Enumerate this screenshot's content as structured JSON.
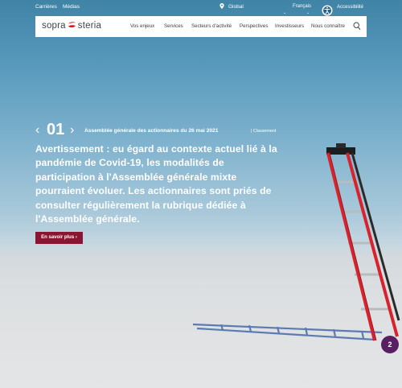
{
  "topbar": {
    "links": [
      "Carrières",
      "Médias"
    ],
    "region": "Global",
    "language": "Français",
    "accessibility": "Accessibilité"
  },
  "navbar": {
    "logo_left": "sopra",
    "logo_right": "steria",
    "items": [
      "Vos enjeux",
      "Services",
      "Secteurs d'activité",
      "Perspectives",
      "Investisseurs",
      "Nous connaître"
    ]
  },
  "hero": {
    "slide_number": "01",
    "event_title": "Assemblée générale des actionnaires du 26 mai 2021",
    "event_category": "Classement",
    "headline": "Avertissement : eu égard au contexte actuel lié à la pandémie de Covid-19, les modalités de participation à l'Assemblée générale mixte pourraient évoluer. Les actionnaires sont priés de consulter régulièrement la rubrique dédiée à l'Assemblée générale.",
    "cta_label": "En savoir plus ›"
  },
  "badge": {
    "count": "2"
  },
  "colors": {
    "brand_red": "#e1131c",
    "cta": "#8a1532",
    "badge": "#5a1e65"
  }
}
